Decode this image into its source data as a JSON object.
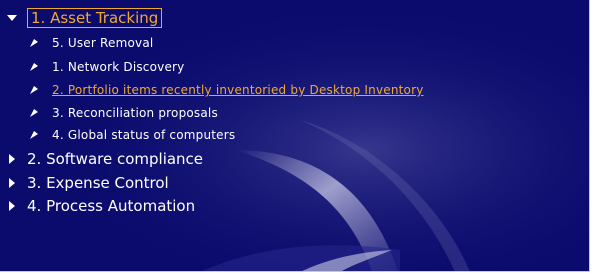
{
  "colors": {
    "background": "#0b0b6e",
    "text": "#ffffff",
    "highlight": "#f0a830"
  },
  "tree": {
    "root": {
      "label": "1. Asset Tracking",
      "expanded": true,
      "icon": "triangle-down-icon"
    },
    "children": [
      {
        "label": "5. User Removal",
        "icon": "arrow-bullet-icon",
        "active": false
      },
      {
        "label": "1. Network Discovery",
        "icon": "arrow-bullet-icon",
        "active": false
      },
      {
        "label": "2. Portfolio items recently inventoried by Desktop Inventory",
        "icon": "arrow-bullet-icon",
        "active": true
      },
      {
        "label": "3. Reconciliation proposals",
        "icon": "arrow-bullet-icon",
        "active": false
      },
      {
        "label": "4. Global status of computers",
        "icon": "arrow-bullet-icon",
        "active": false
      }
    ],
    "collapsed": [
      {
        "label": "2. Software compliance",
        "icon": "triangle-right-icon"
      },
      {
        "label": "3. Expense Control",
        "icon": "triangle-right-icon"
      },
      {
        "label": "4. Process Automation",
        "icon": "triangle-right-icon"
      }
    ]
  }
}
